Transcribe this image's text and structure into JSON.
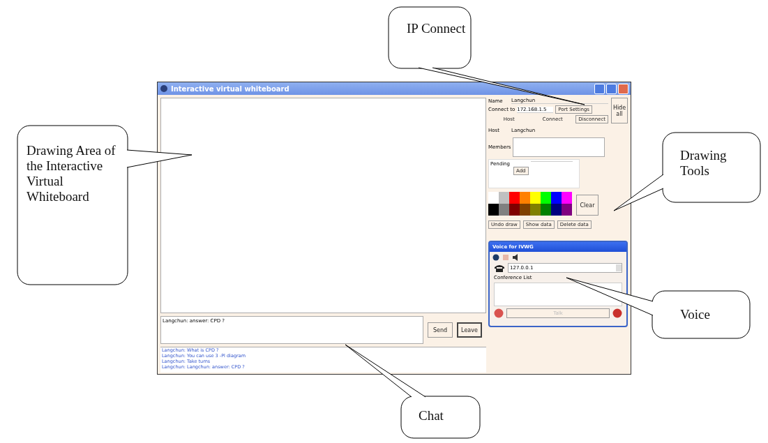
{
  "window": {
    "title": "Interactive virtual whiteboard"
  },
  "connection": {
    "name_label": "Name",
    "name_value": "Langchun",
    "connect_label": "Connect to",
    "connect_value": "172.168.1.5",
    "port_button": "Port Settings",
    "host_button": "Host",
    "connect_button": "Connect",
    "disconnect_button": "Disconnect",
    "side_button": "Hide all"
  },
  "session": {
    "host_label": "Host",
    "host_value": "Langchun",
    "members_label": "Members",
    "pending_label": "Pending",
    "pending_button": "Add"
  },
  "palette": [
    {
      "color": "#ffffff"
    },
    {
      "color": "#c0c0c0"
    },
    {
      "color": "#ff0000"
    },
    {
      "color": "#ff8000"
    },
    {
      "color": "#ffff00"
    },
    {
      "color": "#00ff00"
    },
    {
      "color": "#0000ff"
    },
    {
      "color": "#ff00ff"
    },
    {
      "color": "#000000"
    },
    {
      "color": "#808080"
    },
    {
      "color": "#800000"
    },
    {
      "color": "#804000"
    },
    {
      "color": "#808000"
    },
    {
      "color": "#008000"
    },
    {
      "color": "#000080"
    },
    {
      "color": "#800080"
    }
  ],
  "clear_button": "Clear",
  "data_buttons": [
    "Undo draw",
    "Show data",
    "Delete data"
  ],
  "voice": {
    "title": "Voice for IVWG",
    "address": "127.0.0.1",
    "list_label": "Conference List",
    "talk_button": "Talk",
    "talk_disabled": true
  },
  "chat": {
    "input": "Langchun: answer: CPD ?",
    "send_button": "Send",
    "leave_button": "Leave",
    "log": [
      "Langchun: What is CPD ?",
      "Langchun: You can use 3 -Pl diagram",
      "Langchun: Take turns",
      "Langchun: Langchun: answer: CPD ?"
    ]
  },
  "callouts": [
    {
      "text": "IP Connect"
    },
    {
      "text": "Drawing Area of the Interactive Virtual Whiteboard"
    },
    {
      "text": "Drawing Tools"
    },
    {
      "text": "Voice"
    },
    {
      "text": "Chat"
    }
  ]
}
